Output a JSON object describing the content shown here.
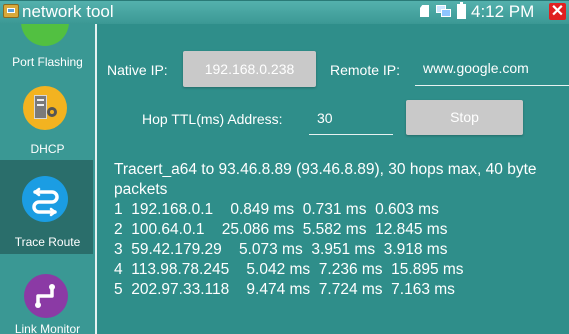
{
  "window": {
    "title": "network tool",
    "clock": "4:12 PM",
    "close_symbol": "✕",
    "icons": [
      "app-icon",
      "sd-card-icon",
      "network-icon",
      "battery-icon",
      "close-icon"
    ]
  },
  "sidebar": {
    "items": [
      {
        "label": "Port Flashing",
        "icon": "port-flashing-icon",
        "color": "#52c041"
      },
      {
        "label": "DHCP",
        "icon": "dhcp-server-icon",
        "color": "#f3b320"
      },
      {
        "label": "Trace Route",
        "icon": "trace-route-icon",
        "color": "#1b9de3",
        "selected": true
      },
      {
        "label": "Link Monitor",
        "icon": "link-monitor-icon",
        "color": "#8b3aa5"
      }
    ]
  },
  "form": {
    "native_ip_label": "Native IP:",
    "native_ip_value": "192.168.0.238",
    "remote_ip_label": "Remote IP:",
    "remote_ip_value": "www.google.com",
    "hop_label": "Hop TTL(ms) Address:",
    "hop_value": "30",
    "stop_label": "Stop"
  },
  "output": {
    "header": "Tracert_a64 to 93.46.8.89 (93.46.8.89), 30 hops max, 40 byte packets",
    "hops": [
      "1  192.168.0.1    0.849 ms  0.731 ms  0.603 ms",
      "2  100.64.0.1    25.086 ms  5.582 ms  12.845 ms",
      "3  59.42.179.29    5.073 ms  3.951 ms  3.918 ms",
      "4  113.98.78.245    5.042 ms  7.236 ms  15.895 ms",
      "5  202.97.33.118    9.474 ms  7.724 ms  7.163 ms"
    ]
  },
  "colors": {
    "background": "#2f8e8a",
    "titlebar": "#4aa7a3",
    "button": "#c9c9c9",
    "close": "#e02020",
    "selected_item": "#2a6e6b"
  }
}
